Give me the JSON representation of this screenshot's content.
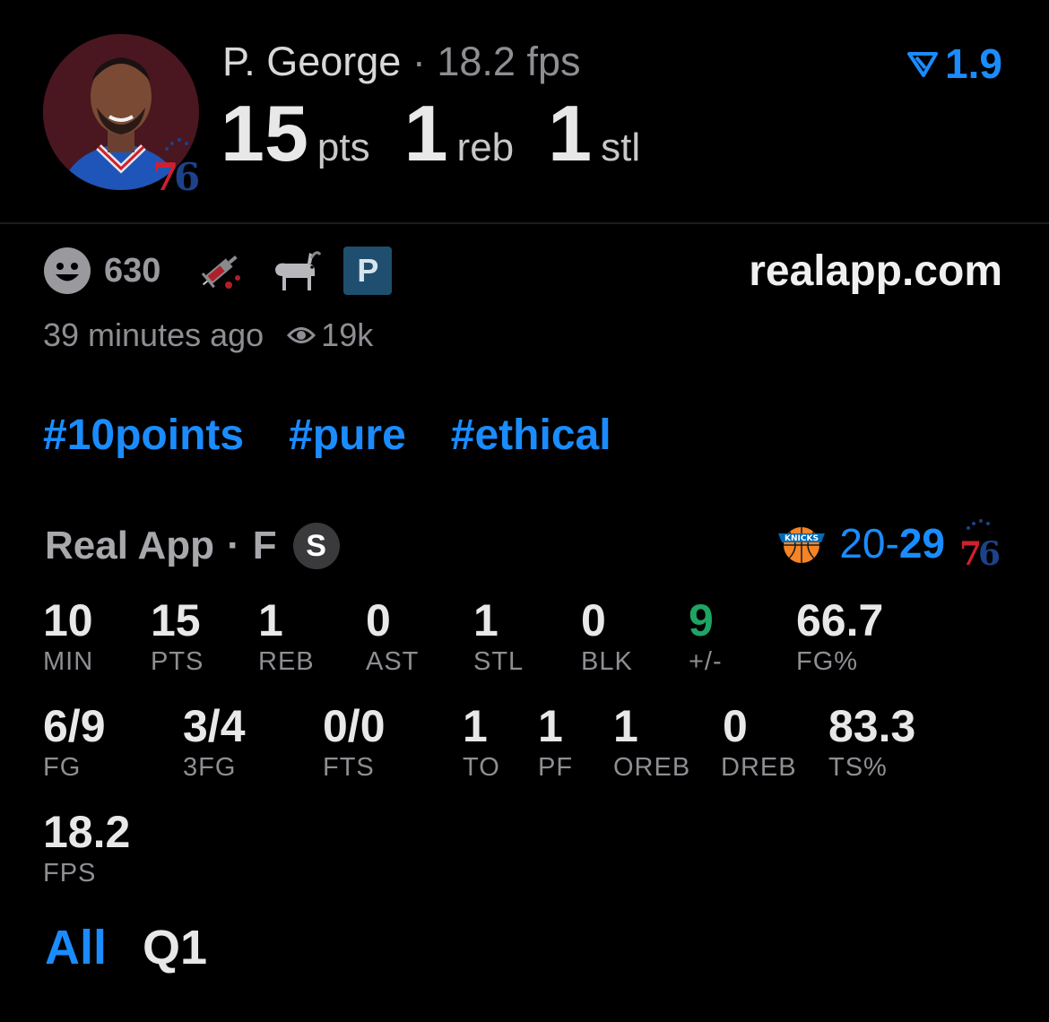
{
  "player": {
    "name": "P. George",
    "separator": "·",
    "fps": "18.2 fps",
    "rating": "1.9",
    "stats": [
      {
        "value": "15",
        "unit": "pts"
      },
      {
        "value": "1",
        "unit": "reb"
      },
      {
        "value": "1",
        "unit": "stl"
      }
    ],
    "team_badge_text": "76"
  },
  "post": {
    "reaction_count": "630",
    "p_badge": "P",
    "site": "realapp.com",
    "time_ago": "39 minutes ago",
    "views": "19k"
  },
  "hashtags": [
    "#10points",
    "#pure",
    "#ethical"
  ],
  "game": {
    "source": "Real App",
    "separator": "·",
    "status": "F",
    "s_badge": "S",
    "away_score": "20",
    "dash": "-",
    "home_score": "29",
    "home_badge_text": "76"
  },
  "stat_grid": [
    {
      "value": "10",
      "label": "MIN"
    },
    {
      "value": "15",
      "label": "PTS"
    },
    {
      "value": "1",
      "label": "REB"
    },
    {
      "value": "0",
      "label": "AST"
    },
    {
      "value": "1",
      "label": "STL"
    },
    {
      "value": "0",
      "label": "BLK"
    },
    {
      "value": "9",
      "label": "+/-"
    },
    {
      "value": "66.7",
      "label": "FG%"
    },
    {
      "value": "6/9",
      "label": "FG"
    },
    {
      "value": "3/4",
      "label": "3FG"
    },
    {
      "value": "0/0",
      "label": "FTS"
    },
    {
      "value": "1",
      "label": "TO"
    },
    {
      "value": "1",
      "label": "PF"
    },
    {
      "value": "1",
      "label": "OREB"
    },
    {
      "value": "0",
      "label": "DREB"
    },
    {
      "value": "83.3",
      "label": "TS%"
    },
    {
      "value": "18.2",
      "label": "FPS"
    }
  ],
  "tabs": [
    {
      "label": "All",
      "active": true
    },
    {
      "label": "Q1",
      "active": false
    }
  ],
  "colors": {
    "accent": "#1a8cff",
    "positive": "#1fa463",
    "muted": "#8e8e93"
  },
  "icons": [
    "smiley-icon",
    "syringe-icon",
    "goat-icon",
    "p-badge-icon",
    "eye-icon",
    "rating-arrow-icon",
    "knicks-logo-icon",
    "sixers-logo-icon"
  ]
}
